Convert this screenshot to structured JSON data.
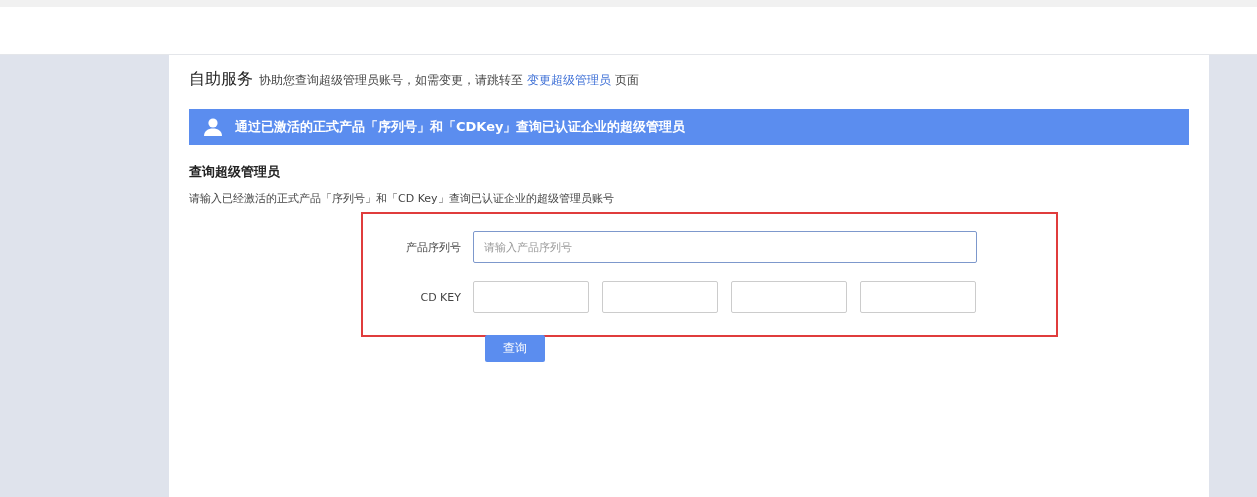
{
  "header": {
    "title": "自助服务",
    "description_before": "协助您查询超级管理员账号，如需变更，请跳转至",
    "link": "变更超级管理员",
    "description_after": "页面"
  },
  "banner": {
    "text": "通过已激活的正式产品「序列号」和「CDKey」查询已认证企业的超级管理员"
  },
  "section": {
    "title": "查询超级管理员",
    "description": "请输入已经激活的正式产品「序列号」和「CD Key」查询已认证企业的超级管理员账号"
  },
  "form": {
    "serial": {
      "label": "产品序列号",
      "placeholder": "请输入产品序列号"
    },
    "cdkey": {
      "label": "CD KEY"
    },
    "submit": "查询"
  }
}
